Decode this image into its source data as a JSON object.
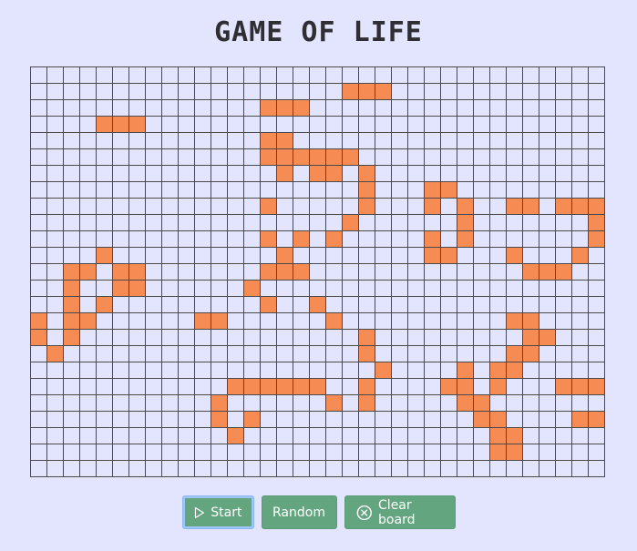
{
  "title": "GAME OF LIFE",
  "board": {
    "rows": 25,
    "cols": 35,
    "alive_cells": [
      [
        1,
        19
      ],
      [
        1,
        20
      ],
      [
        1,
        21
      ],
      [
        2,
        14
      ],
      [
        2,
        15
      ],
      [
        2,
        16
      ],
      [
        3,
        4
      ],
      [
        3,
        5
      ],
      [
        3,
        6
      ],
      [
        4,
        14
      ],
      [
        4,
        15
      ],
      [
        5,
        14
      ],
      [
        5,
        15
      ],
      [
        5,
        16
      ],
      [
        5,
        17
      ],
      [
        5,
        18
      ],
      [
        5,
        19
      ],
      [
        6,
        15
      ],
      [
        6,
        17
      ],
      [
        6,
        18
      ],
      [
        6,
        20
      ],
      [
        7,
        20
      ],
      [
        7,
        24
      ],
      [
        7,
        25
      ],
      [
        8,
        14
      ],
      [
        8,
        20
      ],
      [
        8,
        24
      ],
      [
        8,
        26
      ],
      [
        8,
        29
      ],
      [
        8,
        30
      ],
      [
        8,
        32
      ],
      [
        8,
        33
      ],
      [
        8,
        34
      ],
      [
        9,
        19
      ],
      [
        9,
        26
      ],
      [
        9,
        34
      ],
      [
        10,
        14
      ],
      [
        10,
        16
      ],
      [
        10,
        18
      ],
      [
        10,
        24
      ],
      [
        10,
        26
      ],
      [
        10,
        34
      ],
      [
        11,
        4
      ],
      [
        11,
        15
      ],
      [
        11,
        24
      ],
      [
        11,
        25
      ],
      [
        11,
        29
      ],
      [
        11,
        33
      ],
      [
        12,
        2
      ],
      [
        12,
        3
      ],
      [
        12,
        5
      ],
      [
        12,
        6
      ],
      [
        12,
        14
      ],
      [
        12,
        15
      ],
      [
        12,
        16
      ],
      [
        12,
        30
      ],
      [
        12,
        31
      ],
      [
        12,
        32
      ],
      [
        13,
        2
      ],
      [
        13,
        5
      ],
      [
        13,
        6
      ],
      [
        13,
        13
      ],
      [
        14,
        2
      ],
      [
        14,
        4
      ],
      [
        14,
        14
      ],
      [
        14,
        17
      ],
      [
        15,
        0
      ],
      [
        15,
        2
      ],
      [
        15,
        3
      ],
      [
        15,
        10
      ],
      [
        15,
        11
      ],
      [
        15,
        18
      ],
      [
        15,
        29
      ],
      [
        15,
        30
      ],
      [
        16,
        0
      ],
      [
        16,
        2
      ],
      [
        16,
        20
      ],
      [
        16,
        30
      ],
      [
        16,
        31
      ],
      [
        17,
        1
      ],
      [
        17,
        20
      ],
      [
        17,
        29
      ],
      [
        17,
        30
      ],
      [
        18,
        21
      ],
      [
        18,
        26
      ],
      [
        18,
        28
      ],
      [
        18,
        29
      ],
      [
        19,
        12
      ],
      [
        19,
        13
      ],
      [
        19,
        14
      ],
      [
        19,
        15
      ],
      [
        19,
        16
      ],
      [
        19,
        17
      ],
      [
        19,
        20
      ],
      [
        19,
        25
      ],
      [
        19,
        26
      ],
      [
        19,
        28
      ],
      [
        19,
        32
      ],
      [
        19,
        33
      ],
      [
        19,
        34
      ],
      [
        20,
        11
      ],
      [
        20,
        18
      ],
      [
        20,
        20
      ],
      [
        20,
        26
      ],
      [
        20,
        27
      ],
      [
        21,
        11
      ],
      [
        21,
        13
      ],
      [
        21,
        27
      ],
      [
        21,
        28
      ],
      [
        21,
        33
      ],
      [
        21,
        34
      ],
      [
        22,
        12
      ],
      [
        22,
        28
      ],
      [
        22,
        29
      ],
      [
        23,
        28
      ],
      [
        23,
        29
      ]
    ]
  },
  "controls": {
    "start_label": "Start",
    "random_label": "Random",
    "clear_label": "Clear board"
  },
  "colors": {
    "background": "#e3e4fd",
    "alive_cell": "#f68b54",
    "grid_line": "#4a4a4a",
    "button": "#62a57e"
  },
  "icons": {
    "start": "play-icon",
    "clear": "close-circle-icon"
  }
}
